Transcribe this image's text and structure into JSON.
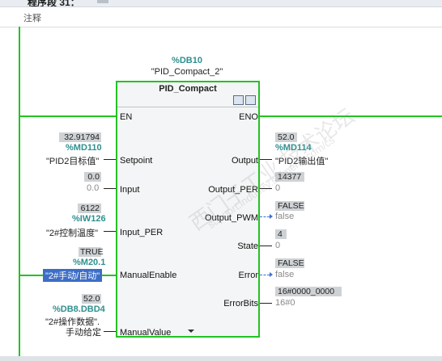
{
  "network": {
    "title": "程序段 31：",
    "comment_label": "注释"
  },
  "block": {
    "db_address": "%DB10",
    "db_name": "\"PID_Compact_2\"",
    "type": "PID_Compact"
  },
  "inputs": {
    "en": {
      "pin": "EN"
    },
    "setpoint": {
      "pin": "Setpoint",
      "value": "32.91794",
      "address": "%MD110",
      "symbol": "\"PID2目标值\""
    },
    "input": {
      "pin": "Input",
      "value": "0.0",
      "symbol": "0.0"
    },
    "input_per": {
      "pin": "Input_PER",
      "value": "6122",
      "address": "%IW126",
      "symbol": "\"2#控制温度\""
    },
    "manual_enable": {
      "pin": "ManualEnable",
      "value": "TRUE",
      "address": "%M20.1",
      "symbol": "\"2#手动/自动\""
    },
    "manual_value": {
      "pin": "ManualValue",
      "value": "52.0",
      "address": "%DB8.DBD4",
      "symbol_line1": "\"2#操作数据\".",
      "symbol_line2": "手动给定"
    }
  },
  "outputs": {
    "eno": {
      "pin": "ENO"
    },
    "output": {
      "pin": "Output",
      "value": "52.0",
      "address": "%MD114",
      "symbol": "\"PID2输出值\""
    },
    "output_per": {
      "pin": "Output_PER",
      "value": "14377",
      "symbol": "0"
    },
    "output_pwm": {
      "pin": "Output_PWM",
      "value": "FALSE",
      "symbol": "false"
    },
    "state": {
      "pin": "State",
      "value": "4",
      "symbol": "0"
    },
    "error": {
      "pin": "Error",
      "value": "FALSE",
      "symbol": "false"
    },
    "errorbits": {
      "pin": "ErrorBits",
      "value": "16#0000_0000",
      "symbol": "16#0"
    }
  },
  "watermark": {
    "line1": "西门子工业 技术论坛",
    "line2": "support.industry.siemens.com/cs"
  },
  "colors": {
    "power_flow": "#23c223",
    "address": "#2f8f8f",
    "selection": "#3d6ec7"
  }
}
